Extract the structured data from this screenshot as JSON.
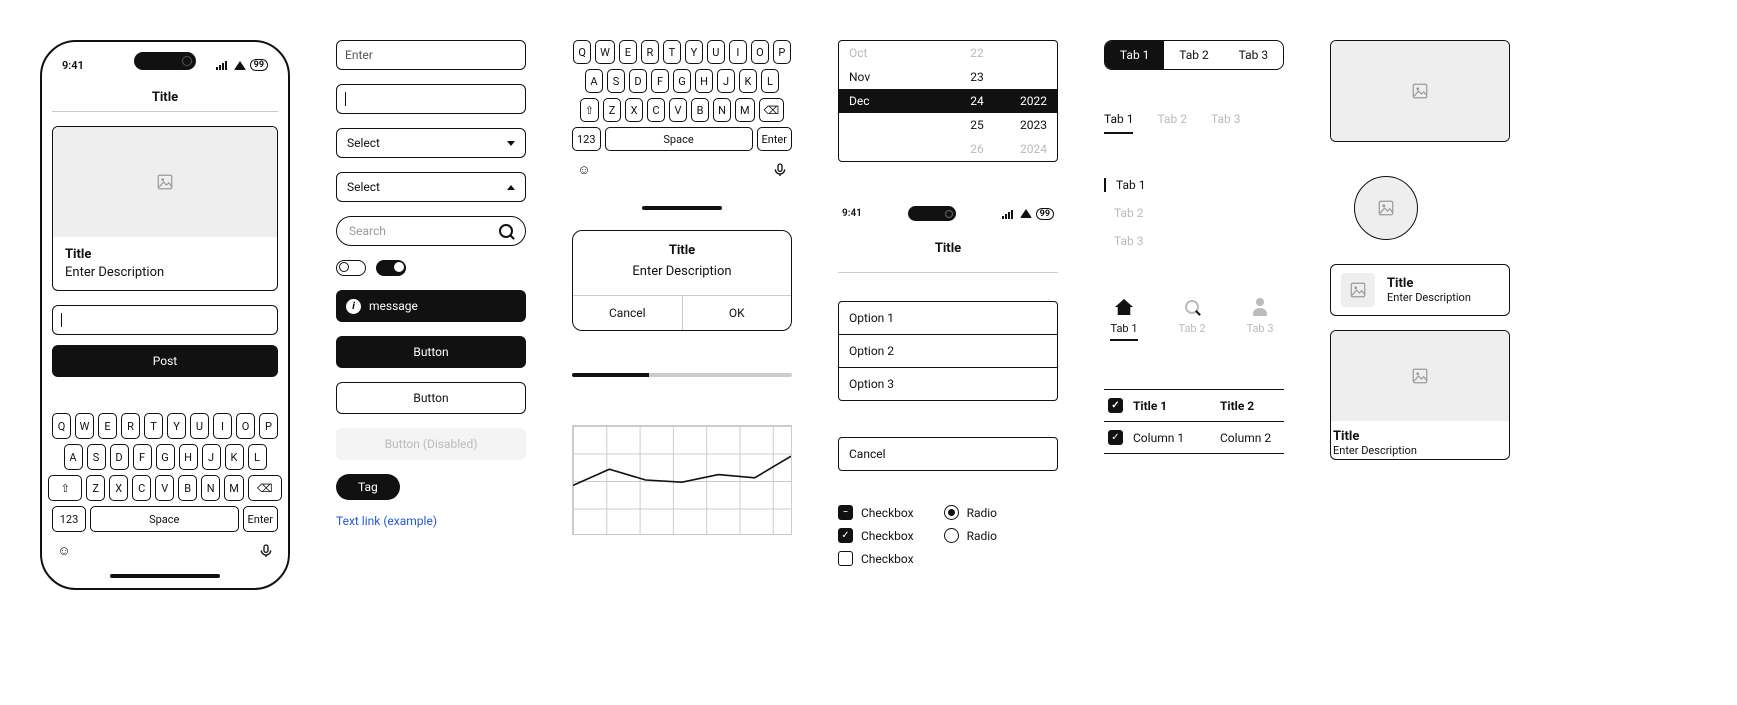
{
  "status": {
    "time": "9:41",
    "battery": "99"
  },
  "phone": {
    "title": "Title",
    "card": {
      "title": "Title",
      "desc": "Enter Description"
    },
    "post": "Post"
  },
  "inputs": {
    "enter": "Enter",
    "select": "Select",
    "search": "Search"
  },
  "message": "message",
  "buttons": {
    "primary": "Button",
    "secondary": "Button",
    "disabled": "Button (Disabled)",
    "tag": "Tag"
  },
  "link": "Text link (example)",
  "keyboard": {
    "rows": [
      [
        "Q",
        "W",
        "E",
        "R",
        "T",
        "Y",
        "U",
        "I",
        "O",
        "P"
      ],
      [
        "A",
        "S",
        "D",
        "F",
        "G",
        "H",
        "J",
        "K",
        "L"
      ],
      [
        "Z",
        "X",
        "C",
        "V",
        "B",
        "N",
        "M"
      ]
    ],
    "num": "123",
    "space": "Space",
    "enter": "Enter"
  },
  "dialog": {
    "title": "Title",
    "desc": "Enter Description",
    "cancel": "Cancel",
    "ok": "OK"
  },
  "chart_data": {
    "type": "line",
    "x": [
      0,
      1,
      2,
      3,
      4,
      5,
      6
    ],
    "values": [
      45,
      60,
      50,
      48,
      55,
      52,
      72
    ],
    "ylim": [
      0,
      100
    ],
    "grid": true
  },
  "picker": {
    "rows": [
      {
        "m": "Oct",
        "d": "22",
        "y": ""
      },
      {
        "m": "Nov",
        "d": "23",
        "y": ""
      },
      {
        "m": "Dec",
        "d": "24",
        "y": "2022"
      },
      {
        "m": "",
        "d": "25",
        "y": "2023"
      },
      {
        "m": "",
        "d": "26",
        "y": "2024"
      }
    ]
  },
  "sheet": {
    "title": "Title",
    "options": [
      "Option 1",
      "Option 2",
      "Option 3"
    ],
    "cancel": "Cancel"
  },
  "checkbox": "Checkbox",
  "radio": "Radio",
  "tabs": {
    "t1": "Tab 1",
    "t2": "Tab 2",
    "t3": "Tab 3"
  },
  "table": {
    "h1": "Title 1",
    "h2": "Title 2",
    "c1": "Column 1",
    "c2": "Column 2"
  },
  "cards": {
    "title": "Title",
    "desc": "Enter Description"
  }
}
